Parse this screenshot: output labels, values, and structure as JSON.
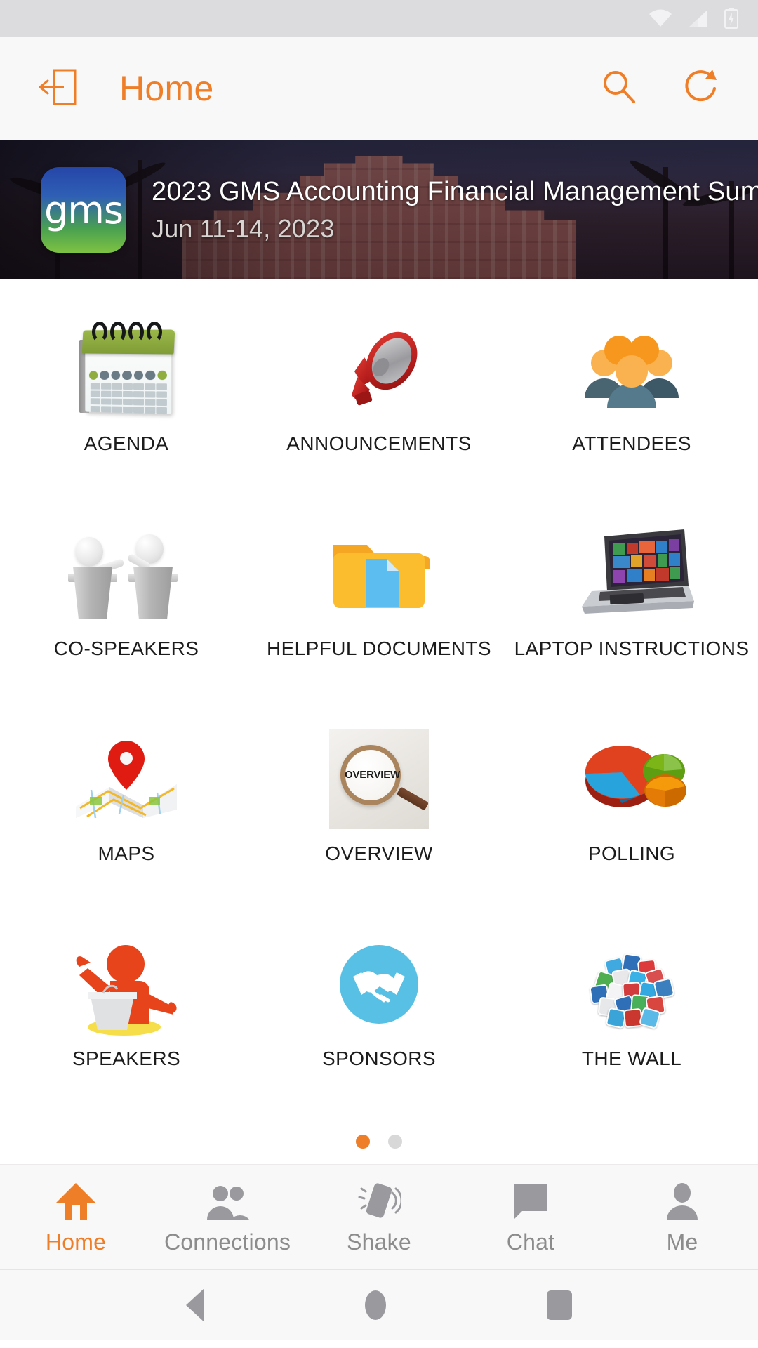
{
  "status_bar": {
    "wifi_icon": "wifi-icon",
    "signal_icon": "cellular-signal-icon",
    "battery_icon": "battery-charging-icon"
  },
  "app_bar": {
    "exit_icon": "exit-logout-icon",
    "title": "Home",
    "search_icon": "search-icon",
    "refresh_icon": "refresh-icon"
  },
  "banner": {
    "logo_text": "gms",
    "logo_name": "gms-event-logo",
    "title": "2023 GMS Accounting Financial Management Sum...",
    "date": "Jun 11-14, 2023",
    "background_name": "hotel-palms-photo"
  },
  "grid": {
    "tiles": [
      {
        "label": "AGENDA",
        "icon": "calendar-icon"
      },
      {
        "label": "ANNOUNCEMENTS",
        "icon": "megaphone-icon"
      },
      {
        "label": "ATTENDEES",
        "icon": "people-group-icon"
      },
      {
        "label": "CO-SPEAKERS",
        "icon": "two-speakers-podium-icon"
      },
      {
        "label": "HELPFUL DOCUMENTS",
        "icon": "folder-document-icon"
      },
      {
        "label": "LAPTOP INSTRUCTIONS",
        "icon": "laptop-icon"
      },
      {
        "label": "MAPS",
        "icon": "map-pin-icon"
      },
      {
        "label": "OVERVIEW",
        "icon": "magnifying-glass-overview-icon"
      },
      {
        "label": "POLLING",
        "icon": "pie-chart-icon"
      },
      {
        "label": "SPEAKERS",
        "icon": "speaker-podium-icon"
      },
      {
        "label": "SPONSORS",
        "icon": "handshake-icon"
      },
      {
        "label": "THE WALL",
        "icon": "social-media-pile-icon"
      }
    ],
    "overview_lens_word": "OVERVIEW"
  },
  "pagination": {
    "total": 2,
    "active_index": 1
  },
  "bottom_nav": {
    "items": [
      {
        "label": "Home",
        "icon": "home-icon",
        "active": true
      },
      {
        "label": "Connections",
        "icon": "people-icon",
        "active": false
      },
      {
        "label": "Shake",
        "icon": "shake-phone-icon",
        "active": false
      },
      {
        "label": "Chat",
        "icon": "chat-bubble-icon",
        "active": false
      },
      {
        "label": "Me",
        "icon": "person-icon",
        "active": false
      }
    ]
  },
  "android_nav": {
    "back_icon": "back-triangle-icon",
    "home_icon": "home-circle-icon",
    "recents_icon": "recents-square-icon"
  },
  "colors": {
    "accent": "#ef7e28",
    "app_bar_bg": "#f8f8f9",
    "status_bar_bg": "#dcdcde",
    "label_text": "#1c1c1c",
    "nav_inactive": "#8c8c8c"
  }
}
